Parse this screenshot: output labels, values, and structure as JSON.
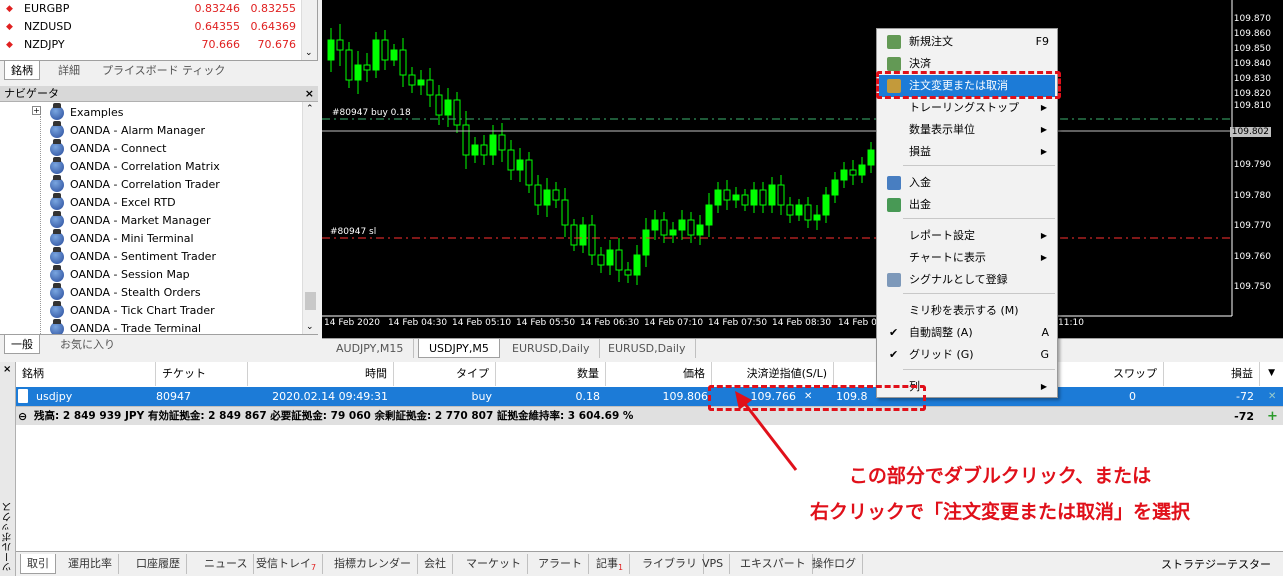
{
  "market_watch": {
    "rows": [
      {
        "symbol": "EURGBP",
        "bid": "0.83246",
        "ask": "0.83255"
      },
      {
        "symbol": "NZDUSD",
        "bid": "0.64355",
        "ask": "0.64369"
      },
      {
        "symbol": "NZDJPY",
        "bid": "70.666",
        "ask": "70.676"
      }
    ],
    "tabs": [
      "銘柄",
      "詳細",
      "プライスボード",
      "ティック"
    ]
  },
  "navigator": {
    "title": "ナビゲータ",
    "items": [
      "Examples",
      "OANDA - Alarm Manager",
      "OANDA - Connect",
      "OANDA - Correlation Matrix",
      "OANDA - Correlation Trader",
      "OANDA - Excel RTD",
      "OANDA - Market Manager",
      "OANDA - Mini Terminal",
      "OANDA - Sentiment Trader",
      "OANDA - Session Map",
      "OANDA - Stealth Orders",
      "OANDA - Tick Chart Trader",
      "OANDA - Trade Terminal"
    ],
    "tabs": [
      "一般",
      "お気に入り"
    ]
  },
  "chart": {
    "price_labels": [
      "109.870",
      "109.860",
      "109.850",
      "109.840",
      "109.830",
      "109.820",
      "109.810",
      "109.802",
      "109.790",
      "109.780",
      "109.770",
      "109.760",
      "109.750"
    ],
    "time_labels": [
      "14 Feb 2020",
      "14 Feb 04:30",
      "14 Feb 05:10",
      "14 Feb 05:50",
      "14 Feb 06:30",
      "14 Feb 07:10",
      "14 Feb 07:50",
      "14 Feb 08:30",
      "14 Feb 09",
      "11:10"
    ],
    "buy_line_text": "#80947 buy 0.18",
    "sl_line_text": "#80947 sl",
    "colors": {
      "candle": "#00ff00",
      "buy_line": "#3cb371",
      "sl_line": "#ff3030",
      "bid_line": "#c0c0c0"
    }
  },
  "chart_tabs": [
    "AUDJPY,M15",
    "USDJPY,M5",
    "EURUSD,Daily",
    "EURUSD,Daily"
  ],
  "terminal": {
    "headers": [
      "銘柄",
      "チケット",
      "時間",
      "タイプ",
      "数量",
      "価格",
      "決済逆指値(S/L)",
      "決済指",
      "スワップ",
      "損益"
    ],
    "trade": {
      "symbol": "usdjpy",
      "ticket": "80947",
      "time": "2020.02.14 09:49:31",
      "type": "buy",
      "volume": "0.18",
      "price": "109.806",
      "sl": "109.766",
      "tp": "109.8",
      "swap": "0",
      "profit": "-72"
    },
    "balance_text": "残高: 2 849 939 JPY  有効証拠金: 2 849 867  必要証拠金: 79 060  余剰証拠金: 2 770 807  証拠金維持率: 3 604.69 %",
    "balance_profit": "-72",
    "side_label": "ツールボックス",
    "tabs": [
      {
        "label": "取引"
      },
      {
        "label": "運用比率"
      },
      {
        "label": "口座履歴"
      },
      {
        "label": "ニュース"
      },
      {
        "label": "受信トレイ",
        "badge": "7"
      },
      {
        "label": "指標カレンダー"
      },
      {
        "label": "会社"
      },
      {
        "label": "マーケット"
      },
      {
        "label": "アラート"
      },
      {
        "label": "記事",
        "badge": "1"
      },
      {
        "label": "ライブラリ"
      },
      {
        "label": "VPS"
      },
      {
        "label": "エキスパート"
      },
      {
        "label": "操作ログ"
      }
    ],
    "strategy_tester": "ストラテジーテスター"
  },
  "context_menu": {
    "items": [
      {
        "label": "新規注文",
        "shortcut": "F9",
        "icon": "new-order-icon"
      },
      {
        "label": "決済",
        "icon": "close-order-icon"
      },
      {
        "label": "注文変更または取消",
        "icon": "modify-order-icon",
        "highlight": true
      },
      {
        "label": "トレーリングストップ",
        "submenu": true
      },
      {
        "label": "数量表示単位",
        "submenu": true
      },
      {
        "label": "損益",
        "submenu": true
      },
      {
        "label": "入金",
        "icon": "deposit-icon"
      },
      {
        "label": "出金",
        "icon": "withdraw-icon"
      },
      {
        "label": "レポート設定",
        "submenu": true
      },
      {
        "label": "チャートに表示",
        "submenu": true
      },
      {
        "label": "シグナルとして登録",
        "icon": "signal-icon"
      },
      {
        "label": "ミリ秒を表示する (M)"
      },
      {
        "label": "自動調整 (A)",
        "shortcut": "A",
        "checked": true
      },
      {
        "label": "グリッド (G)",
        "shortcut": "G",
        "checked": true
      },
      {
        "label": "列",
        "submenu": true
      }
    ]
  },
  "annotation": {
    "line1": "この部分でダブルクリック、または",
    "line2": "右クリックで「注文変更または取消」を選択",
    "color": "#e0101a"
  }
}
